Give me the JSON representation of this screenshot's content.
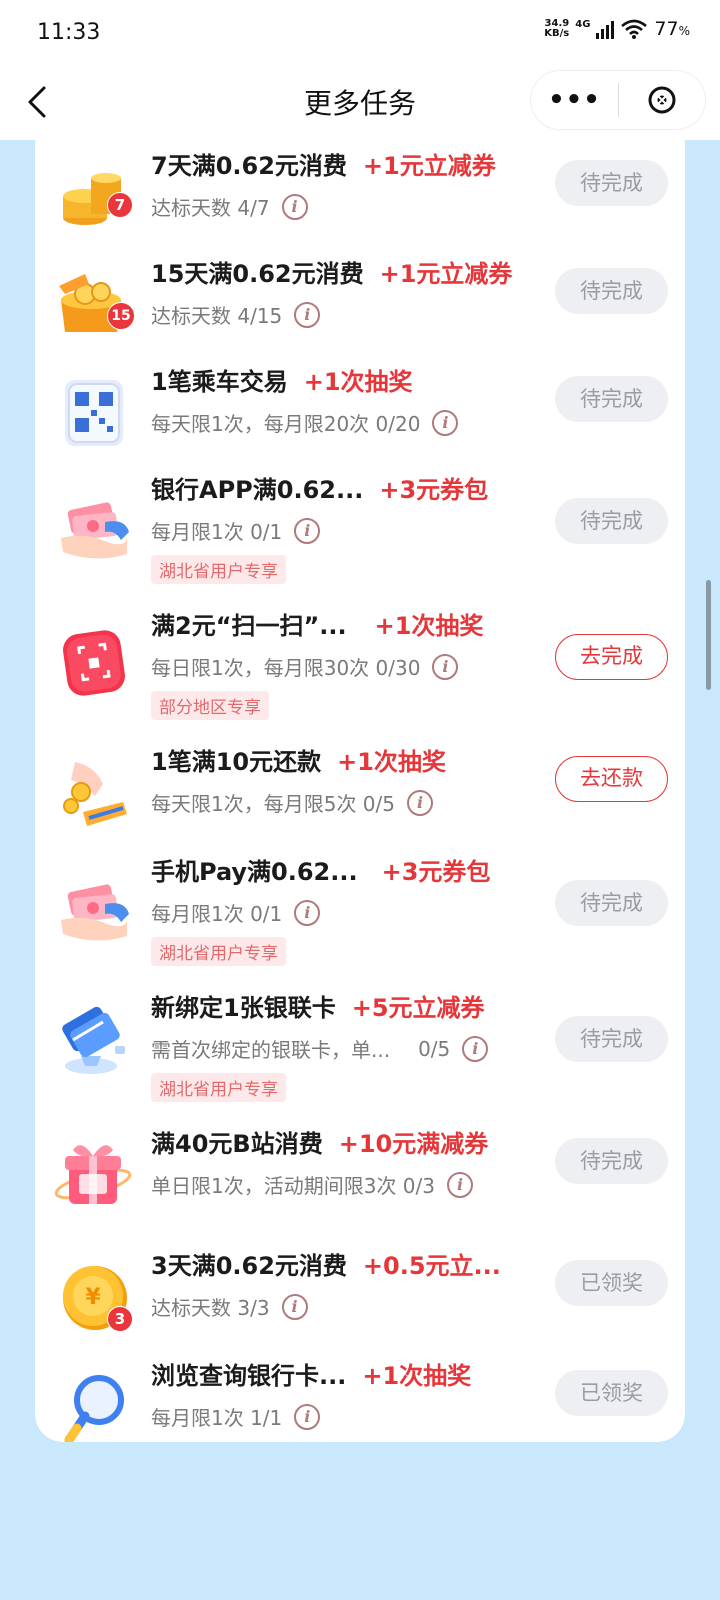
{
  "status_bar": {
    "time": "11:33",
    "net_speed_value": "34.9",
    "net_speed_unit": "KB/s",
    "net_type": "4G",
    "battery": "77",
    "battery_unit": "%"
  },
  "nav": {
    "title": "更多任务",
    "more_label": "•••"
  },
  "tasks": [
    {
      "title": "7天满0.62元消费",
      "reward": "+1元立减券",
      "desc": "达标天数 4/7",
      "tag": "",
      "button": "待完成",
      "badge": "7",
      "icon": "coin-stack-icon"
    },
    {
      "title": "15天满0.62元消费",
      "reward": "+1元立减券",
      "desc": "达标天数 4/15",
      "tag": "",
      "button": "待完成",
      "badge": "15",
      "icon": "coin-box-icon"
    },
    {
      "title": "1笔乘车交易",
      "reward": "+1次抽奖",
      "desc": "每天限1次，每月限20次 0/20",
      "tag": "",
      "button": "待完成",
      "badge": "",
      "icon": "qr-code-icon"
    },
    {
      "title": "银行APP满0.62...",
      "reward": "+3元券包",
      "desc": "每月限1次 0/1",
      "tag": "湖北省用户专享",
      "button": "待完成",
      "badge": "",
      "icon": "cash-hand-icon"
    },
    {
      "title": "满2元“扫一扫”...",
      "reward": "+1次抽奖",
      "desc": "每日限1次，每月限30次 0/30",
      "tag": "部分地区专享",
      "button": "去完成",
      "badge": "",
      "icon": "scan-icon"
    },
    {
      "title": "1笔满10元还款",
      "reward": "+1次抽奖",
      "desc": "每天限1次，每月限5次 0/5",
      "tag": "",
      "button": "去还款",
      "badge": "",
      "icon": "repay-hand-icon"
    },
    {
      "title": "手机Pay满0.62...",
      "reward": "+3元券包",
      "desc": "每月限1次 0/1",
      "tag": "湖北省用户专享",
      "button": "待完成",
      "badge": "",
      "icon": "cash-hand-icon"
    },
    {
      "title": "新绑定1张银联卡",
      "reward": "+5元立减券",
      "desc": "需首次绑定的银联卡，单...",
      "desc_count": "0/5",
      "tag": "湖北省用户专享",
      "button": "待完成",
      "badge": "",
      "icon": "bank-card-icon"
    },
    {
      "title": "满40元B站消费",
      "reward": "+10元满减券",
      "desc": "单日限1次，活动期间限3次 0/3",
      "tag": "",
      "button": "待完成",
      "badge": "",
      "icon": "gift-box-icon"
    },
    {
      "title": "3天满0.62元消费",
      "reward": "+0.5元立...",
      "desc": "达标天数 3/3",
      "tag": "",
      "button": "已领奖",
      "badge": "3",
      "icon": "yuan-coin-icon"
    },
    {
      "title": "浏览查询银行卡...",
      "reward": "+1次抽奖",
      "desc": "每月限1次 1/1",
      "tag": "",
      "button": "已领奖",
      "badge": "",
      "icon": "magnifier-icon"
    }
  ],
  "colors": {
    "background": "#c9e8fb",
    "accent_red": "#e5373a",
    "button_grey": "#eeeff3"
  }
}
